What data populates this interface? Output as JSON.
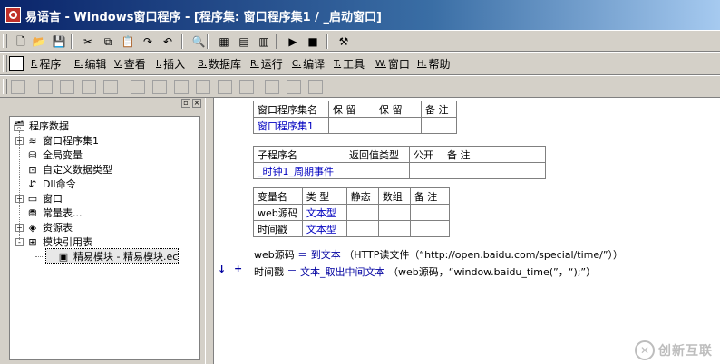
{
  "window": {
    "title": "易语言 - Windows窗口程序 - [程序集: 窗口程序集1 / _启动窗口]"
  },
  "toolbar1": {
    "buttons": [
      {
        "name": "new-file-icon",
        "glyph": "🗋"
      },
      {
        "name": "open-folder-icon",
        "glyph": "📂"
      },
      {
        "name": "save-icon",
        "glyph": "💾"
      },
      {
        "name": "cut-icon",
        "glyph": "✂"
      },
      {
        "name": "copy-icon",
        "glyph": "⧉"
      },
      {
        "name": "paste-icon",
        "glyph": "📋"
      },
      {
        "name": "redo-icon",
        "glyph": "↷"
      },
      {
        "name": "undo-icon",
        "glyph": "↶"
      },
      {
        "name": "find-icon",
        "glyph": "🔍"
      },
      {
        "name": "layout1-icon",
        "glyph": "▦"
      },
      {
        "name": "layout2-icon",
        "glyph": "▤"
      },
      {
        "name": "layout3-icon",
        "glyph": "▥"
      },
      {
        "name": "run-icon",
        "glyph": "▶"
      },
      {
        "name": "stop-icon",
        "glyph": "■"
      },
      {
        "name": "compile-icon",
        "glyph": "⚒"
      }
    ]
  },
  "menu": {
    "items": [
      {
        "key": "F.",
        "label": "程序"
      },
      {
        "key": "E.",
        "label": "编辑"
      },
      {
        "key": "V.",
        "label": "查看"
      },
      {
        "key": "I.",
        "label": "插入"
      },
      {
        "key": "B.",
        "label": "数据库"
      },
      {
        "key": "R.",
        "label": "运行"
      },
      {
        "key": "C.",
        "label": "编译"
      },
      {
        "key": "T.",
        "label": "工具"
      },
      {
        "key": "W.",
        "label": "窗口"
      },
      {
        "key": "H.",
        "label": "帮助"
      }
    ]
  },
  "left_panel": {
    "tree": {
      "root": "程序数据",
      "items": [
        {
          "label": "窗口程序集1",
          "icon": "stack-icon",
          "glyph": "≋",
          "expander": "+"
        },
        {
          "label": "全局变量",
          "icon": "database-icon",
          "glyph": "⛁",
          "expander": ""
        },
        {
          "label": "自定义数据类型",
          "icon": "type-icon",
          "glyph": "⊡",
          "expander": ""
        },
        {
          "label": "Dll命令",
          "icon": "dll-icon",
          "glyph": "⇵",
          "expander": ""
        },
        {
          "label": "窗口",
          "icon": "window-icon",
          "glyph": "▭",
          "expander": "+"
        },
        {
          "label": "常量表...",
          "icon": "constants-icon",
          "glyph": "⛃",
          "expander": ""
        },
        {
          "label": "资源表",
          "icon": "resources-icon",
          "glyph": "◈",
          "expander": "+"
        },
        {
          "label": "模块引用表",
          "icon": "module-table-icon",
          "glyph": "⊞",
          "expander": "-"
        },
        {
          "label": "精易模块 - 精易模块.ec",
          "icon": "module-icon",
          "glyph": "▣",
          "expander": ""
        }
      ]
    }
  },
  "editor": {
    "assembly_table": {
      "headers": [
        "窗口程序集名",
        "保 留",
        "保 留",
        "备 注"
      ],
      "rows": [
        [
          "窗口程序集1",
          "",
          "",
          ""
        ]
      ]
    },
    "sub_table": {
      "headers": [
        "子程序名",
        "返回值类型",
        "公开",
        "备 注"
      ],
      "rows": [
        [
          "_时钟1_周期事件",
          "",
          "",
          ""
        ]
      ]
    },
    "var_table": {
      "headers": [
        "变量名",
        "类 型",
        "静态",
        "数组",
        "备 注"
      ],
      "rows": [
        [
          "web源码",
          "文本型",
          "",
          "",
          ""
        ],
        [
          "时间戳",
          "文本型",
          "",
          "",
          ""
        ]
      ]
    },
    "code": {
      "line1": {
        "var": "web源码",
        "op": "＝",
        "fn": "到文本",
        "args": "（HTTP读文件（“http://open.baidu.com/special/time/”））"
      },
      "line2": {
        "var": "时间戳",
        "op": "＝",
        "fn": "文本_取出中间文本",
        "args": "（web源码，“window.baidu_time(”，“);”）"
      }
    },
    "markers": {
      "arrow": "↓",
      "plus": "+"
    }
  },
  "watermark": {
    "text": "创新互联"
  }
}
